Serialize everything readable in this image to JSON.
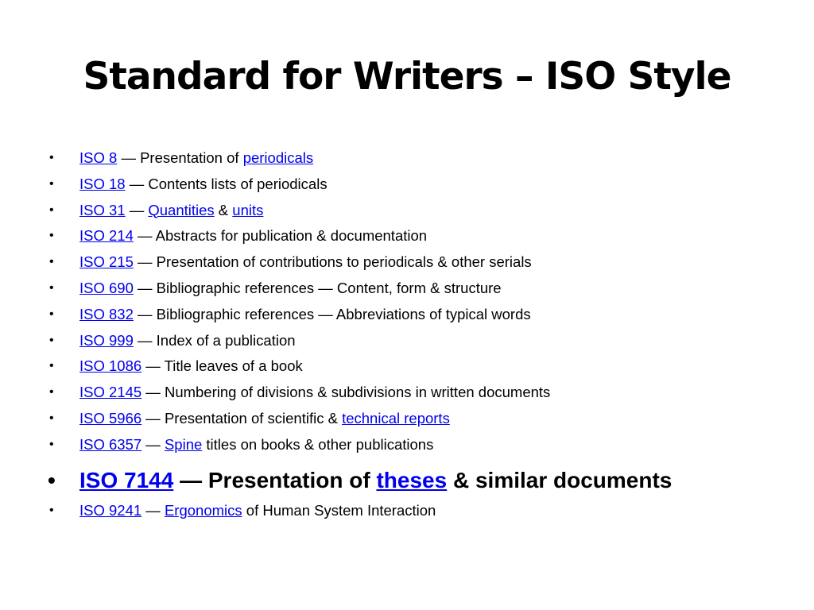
{
  "title": "Standard for Writers – ISO Style",
  "bullet": "•",
  "items": [
    {
      "code": "ISO 8",
      "sep": " — ",
      "t1": "Presentation of ",
      "link2": "periodicals",
      "t2": "",
      "link3": "",
      "t3": ""
    },
    {
      "code": "ISO 18",
      "sep": " — ",
      "t1": "Contents lists of periodicals",
      "link2": "",
      "t2": "",
      "link3": "",
      "t3": ""
    },
    {
      "code": "ISO 31",
      "sep": " — ",
      "t1": "",
      "link2": "Quantities",
      "t2": " & ",
      "link3": "units",
      "t3": ""
    },
    {
      "code": "ISO 214",
      "sep": " — ",
      "t1": "Abstracts for publication & documentation",
      "link2": "",
      "t2": "",
      "link3": "",
      "t3": ""
    },
    {
      "code": "ISO 215",
      "sep": " — ",
      "t1": "Presentation of contributions to periodicals & other serials",
      "link2": "",
      "t2": "",
      "link3": "",
      "t3": ""
    },
    {
      "code": "ISO 690",
      "sep": " — ",
      "t1": "Bibliographic references — Content, form & structure",
      "link2": "",
      "t2": "",
      "link3": "",
      "t3": ""
    },
    {
      "code": "ISO 832",
      "sep": " — ",
      "t1": "Bibliographic references — Abbreviations of typical words",
      "link2": "",
      "t2": "",
      "link3": "",
      "t3": ""
    },
    {
      "code": "ISO 999",
      "sep": " — ",
      "t1": "Index of a publication",
      "link2": "",
      "t2": "",
      "link3": "",
      "t3": ""
    },
    {
      "code": "ISO 1086",
      "sep": " — ",
      "t1": "Title leaves of a book",
      "link2": "",
      "t2": "",
      "link3": "",
      "t3": ""
    },
    {
      "code": "ISO 2145",
      "sep": " — ",
      "t1": "Numbering of divisions & subdivisions in written documents",
      "link2": "",
      "t2": "",
      "link3": "",
      "t3": ""
    },
    {
      "code": "ISO 5966",
      "sep": " — ",
      "t1": "Presentation of scientific & ",
      "link2": "technical reports",
      "t2": "",
      "link3": "",
      "t3": ""
    },
    {
      "code": "ISO 6357",
      "sep": " — ",
      "t1": "",
      "link2": "Spine",
      "t2": " titles on books & other publications",
      "link3": "",
      "t3": ""
    },
    {
      "code": "ISO 7144",
      "sep": " — ",
      "t1": "Presentation of ",
      "link2": "theses",
      "t2": " & similar documents",
      "link3": "",
      "t3": "",
      "emphasis": true
    },
    {
      "code": "ISO 9241",
      "sep": " — ",
      "t1": "",
      "link2": "Ergonomics",
      "t2": " of Human System Interaction",
      "link3": "",
      "t3": ""
    }
  ],
  "colors": {
    "link": "#0000ee",
    "text": "#000000",
    "background": "#ffffff"
  }
}
